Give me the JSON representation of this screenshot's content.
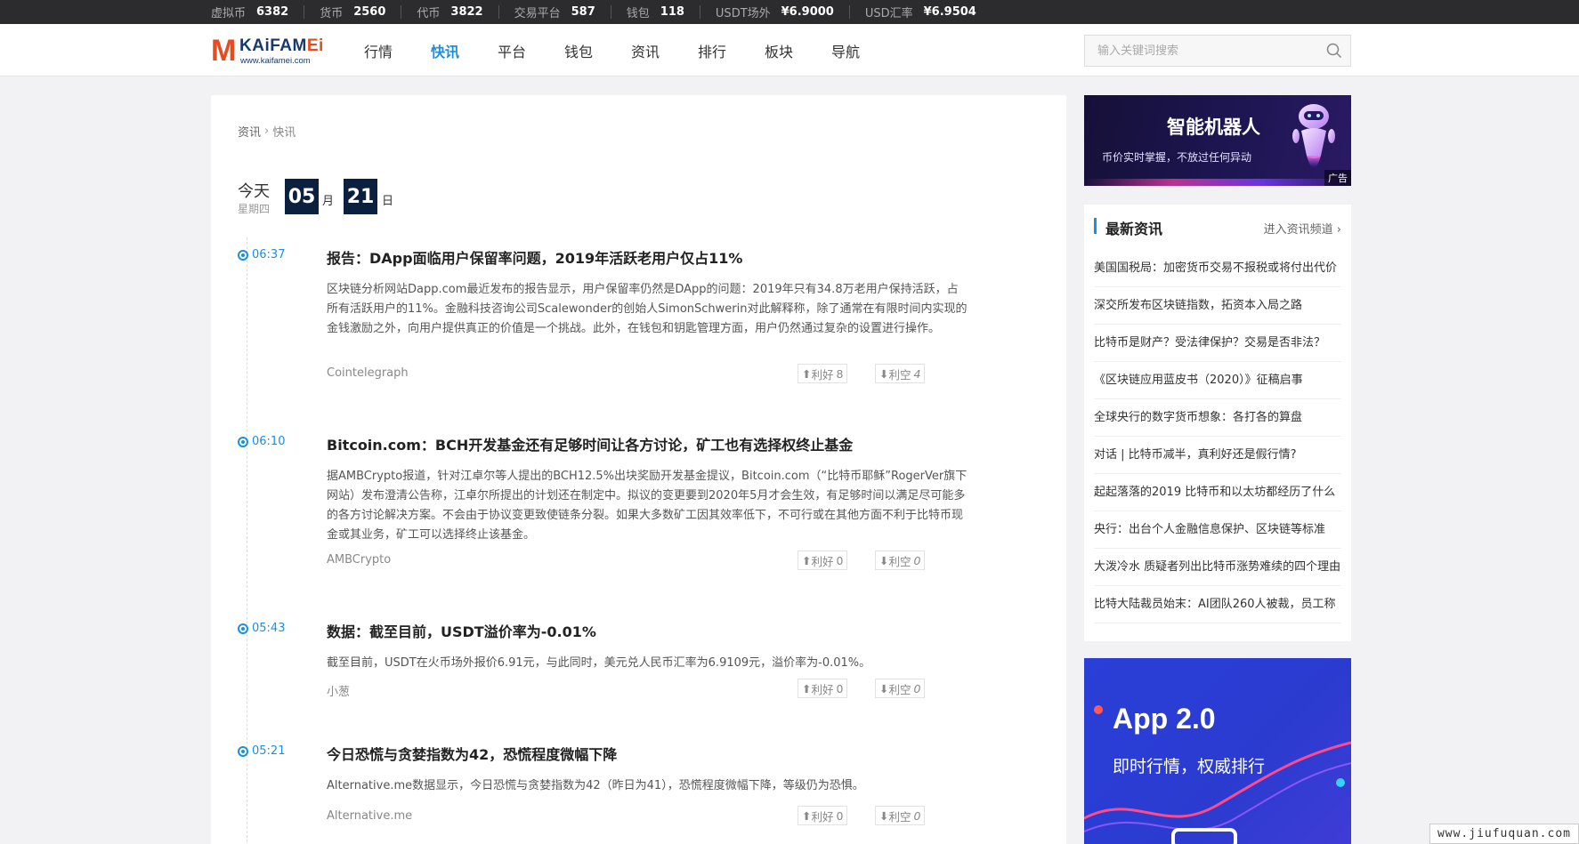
{
  "top_stats": [
    {
      "label": "虚拟币",
      "value": "6382"
    },
    {
      "label": "货币",
      "value": "2560"
    },
    {
      "label": "代币",
      "value": "3822"
    },
    {
      "label": "交易平台",
      "value": "587"
    },
    {
      "label": "钱包",
      "value": "118"
    },
    {
      "label": "USDT场外",
      "value": "¥6.9000"
    },
    {
      "label": "USD汇率",
      "value": "¥6.9504"
    }
  ],
  "logo": {
    "m": "M",
    "word_a": "KAiFAM",
    "word_b": "Ei",
    "url": "www.kaifamei.com"
  },
  "nav": [
    {
      "label": "行情",
      "active": false
    },
    {
      "label": "快讯",
      "active": true
    },
    {
      "label": "平台",
      "active": false
    },
    {
      "label": "钱包",
      "active": false
    },
    {
      "label": "资讯",
      "active": false
    },
    {
      "label": "排行",
      "active": false
    },
    {
      "label": "板块",
      "active": false
    },
    {
      "label": "导航",
      "active": false
    }
  ],
  "search": {
    "placeholder": "输入关键词搜索"
  },
  "breadcrumb": {
    "root": "资讯",
    "separator": "›",
    "current": "快讯"
  },
  "date": {
    "today": "今天",
    "weekday": "星期四",
    "month": "05",
    "month_unit": "月",
    "day": "21",
    "day_unit": "日"
  },
  "news": [
    {
      "time": "06:37",
      "title": "报告：DApp面临用户保留率问题，2019年活跃老用户仅占11%",
      "desc": "区块链分析网站Dapp.com最近发布的报告显示，用户保留率仍然是DApp的问题：2019年只有34.8万老用户保持活跃，占所有活跃用户的11%。金融科技咨询公司Scalewonder的创始人SimonSchwerin对此解释称，除了通常在有限时间内实现的金钱激励之外，向用户提供真正的价值是一个挑战。此外，在钱包和钥匙管理方面，用户仍然通过复杂的设置进行操作。",
      "source": "Cointelegraph",
      "up_label": "利好",
      "up_count": "8",
      "down_label": "利空",
      "down_count": "4"
    },
    {
      "time": "06:10",
      "title": "Bitcoin.com：BCH开发基金还有足够时间让各方讨论，矿工也有选择权终止基金",
      "desc": "据AMBCrypto报道，针对江卓尔等人提出的BCH12.5%出块奖励开发基金提议，Bitcoin.com（“比特币耶稣”RogerVer旗下网站）发布澄清公告称，江卓尔所提出的计划还在制定中。拟议的变更要到2020年5月才会生效，有足够时间以满足尽可能多的各方讨论解决方案。不会由于协议变更致使链条分裂。如果大多数矿工因其效率低下，不可行或在其他方面不利于比特币现金或其业务，矿工可以选择终止该基金。",
      "source": "AMBCrypto",
      "up_label": "利好",
      "up_count": "0",
      "down_label": "利空",
      "down_count": "0"
    },
    {
      "time": "05:43",
      "title": "数据：截至目前，USDT溢价率为-0.01%",
      "desc": "截至目前，USDT在火币场外报价6.91元，与此同时，美元兑人民币汇率为6.9109元，溢价率为-0.01%。",
      "source": "小葱",
      "up_label": "利好",
      "up_count": "0",
      "down_label": "利空",
      "down_count": "0"
    },
    {
      "time": "05:21",
      "title": "今日恐慌与贪婪指数为42，恐慌程度微幅下降",
      "desc": "Alternative.me数据显示，今日恐慌与贪婪指数为42（昨日为41），恐慌程度微幅下降，等级仍为恐惧。",
      "source": "Alternative.me",
      "up_label": "利好",
      "up_count": "0",
      "down_label": "利空",
      "down_count": "0"
    }
  ],
  "ad_top": {
    "headline": "智能机器人",
    "sub": "币价实时掌握，不放过任何异动",
    "tag": "广告"
  },
  "latest": {
    "title": "最新资讯",
    "more": "进入资讯频道",
    "items": [
      "美国国税局：加密货币交易不报税或将付出代价",
      "深交所发布区块链指数，拓资本入局之路",
      "比特币是财产？受法律保护？交易是否非法？",
      "《区块链应用蓝皮书（2020）》征稿启事",
      "全球央行的数字货币想象：各打各的算盘",
      "对话 | 比特币减半，真利好还是假行情?",
      "起起落落的2019 比特币和以太坊都经历了什么",
      "央行：出台个人金融信息保护、区块链等标准",
      "大泼冷水 质疑者列出比特币涨势难续的四个理由",
      "比特大陆裁员始末：AI团队260人被裁，员工称"
    ]
  },
  "ad_bottom": {
    "headline": "App 2.0",
    "sub": "即时行情，权威排行"
  },
  "watermark": "www.jiufuquan.com",
  "colors": {
    "accent": "#1a8fe3",
    "topbar": "#2c2c2e",
    "date_box": "#0b1f3f",
    "logo_orange": "#e84c1e",
    "logo_navy": "#1a3a6e"
  }
}
